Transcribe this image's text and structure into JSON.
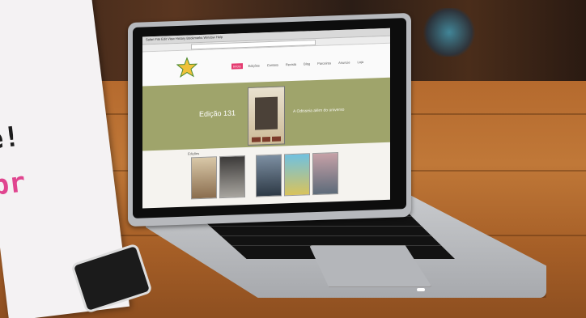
{
  "sign": {
    "line1": "e!",
    "line2": "br",
    "accent_color": "#e0458f"
  },
  "browser": {
    "menu_text": "Safari  File  Edit  View  History  Bookmarks  Window  Help"
  },
  "site": {
    "logo": "star-logo",
    "nav_items": [
      "Início",
      "Edições",
      "Contato",
      "Revista",
      "Blog",
      "Parceiros",
      "Anuncie",
      "Loja"
    ],
    "active_nav_index": 0,
    "hero": {
      "title": "Edição 131",
      "caption": "A Odisseia além do universo",
      "background": "#9fa46b"
    },
    "section_label": "Edições"
  }
}
